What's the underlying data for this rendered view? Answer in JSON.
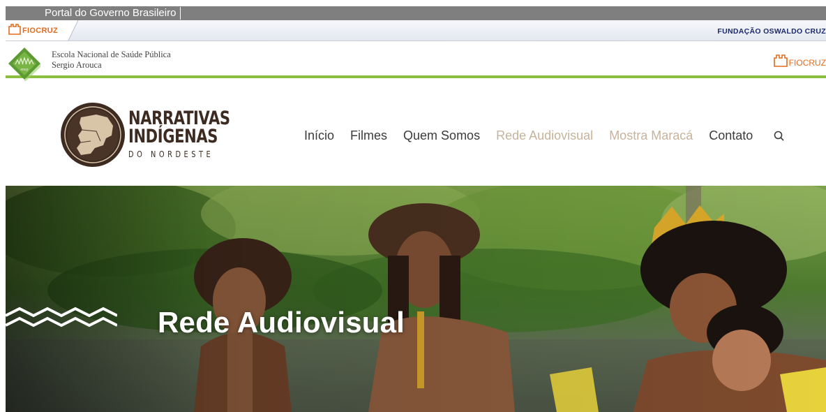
{
  "gov_bar": {
    "label": "Portal do Governo Brasileiro"
  },
  "fiocruz_bar": {
    "logo_text": "FIOCRUZ",
    "org_name": "FUNDAÇÃO OSWALDO CRUZ"
  },
  "ensp_bar": {
    "logo_text": "ensp",
    "line1": "Escola Nacional de Saúde Pública",
    "line2": "Sergio Arouca",
    "right_logo_text": "FIOCRUZ"
  },
  "brand": {
    "line1": "NARRATIVAS",
    "line2": "INDÍGENAS",
    "line3": "DO NORDESTE"
  },
  "nav": {
    "items": [
      {
        "label": "Início",
        "muted": false
      },
      {
        "label": "Filmes",
        "muted": false
      },
      {
        "label": "Quem Somos",
        "muted": false
      },
      {
        "label": "Rede Audiovisual",
        "muted": true
      },
      {
        "label": "Mostra Maracá",
        "muted": true
      },
      {
        "label": "Contato",
        "muted": false
      }
    ],
    "search_icon": "search-icon"
  },
  "hero": {
    "title": "Rede Audiovisual"
  },
  "colors": {
    "gov_bar": "#7f7f7f",
    "fiocruz_orange": "#e36a1c",
    "fiocruz_navy": "#1b2a6b",
    "ensp_green": "#8cbf3f",
    "brand_brown": "#3d2b22",
    "nav_muted": "#c5b39b"
  }
}
